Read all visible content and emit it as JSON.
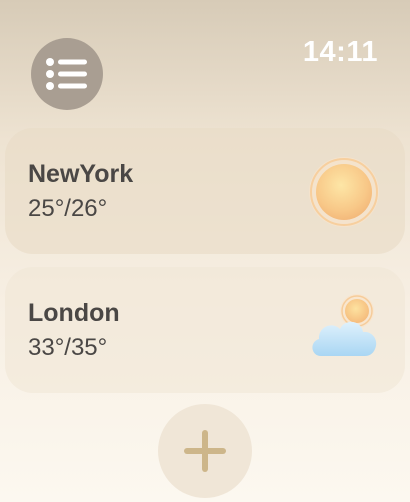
{
  "status_bar": {
    "time": "14:11"
  },
  "toolbar": {
    "menu_icon": "list-icon",
    "add_icon": "plus-icon"
  },
  "locations": [
    {
      "city": "NewYork",
      "temperature": "25°/26°",
      "condition_icon": "sun-icon"
    },
    {
      "city": "London",
      "temperature": "33°/35°",
      "condition_icon": "cloud-sun-icon"
    }
  ],
  "colors": {
    "menu_button": "#a99e92",
    "text": "#4a4745",
    "plus": "#cdb68a"
  }
}
